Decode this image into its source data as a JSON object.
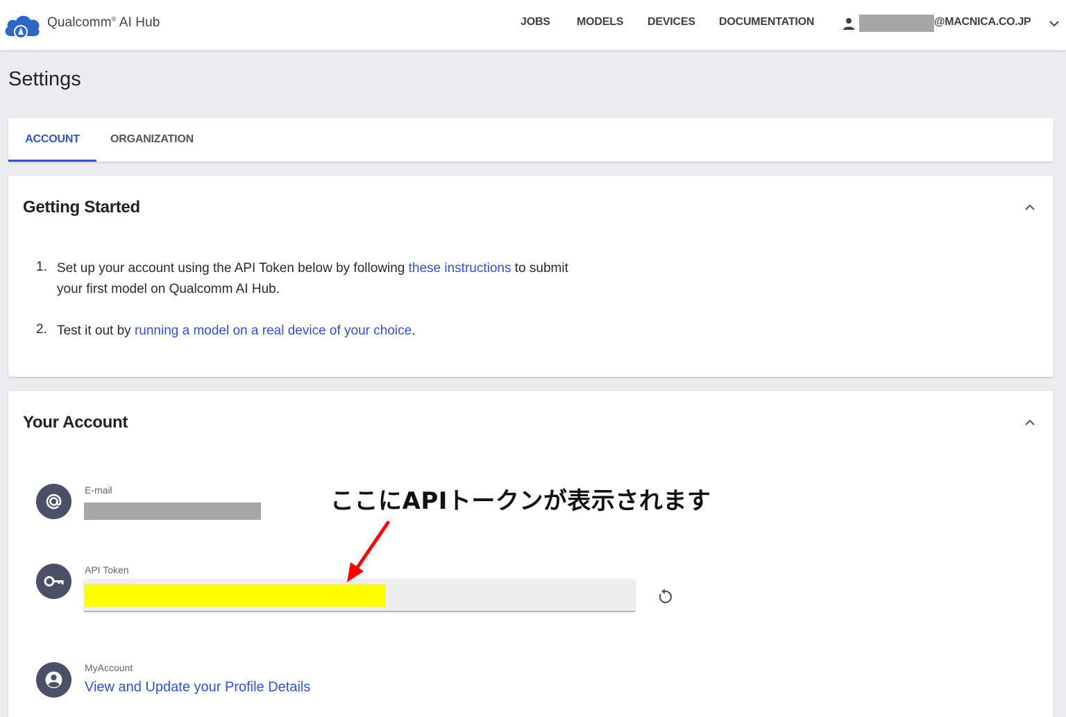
{
  "header": {
    "brand": "Qualcomm",
    "brand_mark": "®",
    "brand_suffix": " AI Hub",
    "nav": [
      "JOBS",
      "MODELS",
      "DEVICES",
      "DOCUMENTATION"
    ],
    "user_email_suffix": "@MACNICA.CO.JP"
  },
  "page": {
    "title": "Settings"
  },
  "tabs": [
    "ACCOUNT",
    "ORGANIZATION"
  ],
  "getting_started": {
    "title": "Getting Started",
    "steps": [
      {
        "num": "1.",
        "before": "Set up your account using the API Token below by following ",
        "link": "these instructions",
        "after": " to submit",
        "line2": "your first model on Qualcomm AI Hub."
      },
      {
        "num": "2.",
        "before": "Test it out by ",
        "link": "running a model on a real device of your choice",
        "after": "."
      }
    ]
  },
  "your_account": {
    "title": "Your Account",
    "email_label": "E-mail",
    "api_token_label": "API Token",
    "myaccount_label": "MyAccount",
    "profile_link": "View and Update your Profile Details"
  },
  "annotation": {
    "text": "ここにAPIトークンが表示されます",
    "arrow_color": "#ff0000",
    "highlight_color": "#ffff00"
  },
  "colors": {
    "accent": "#3351c8",
    "icon_bg": "#4a5166",
    "redaction": "#a6a6a6"
  }
}
